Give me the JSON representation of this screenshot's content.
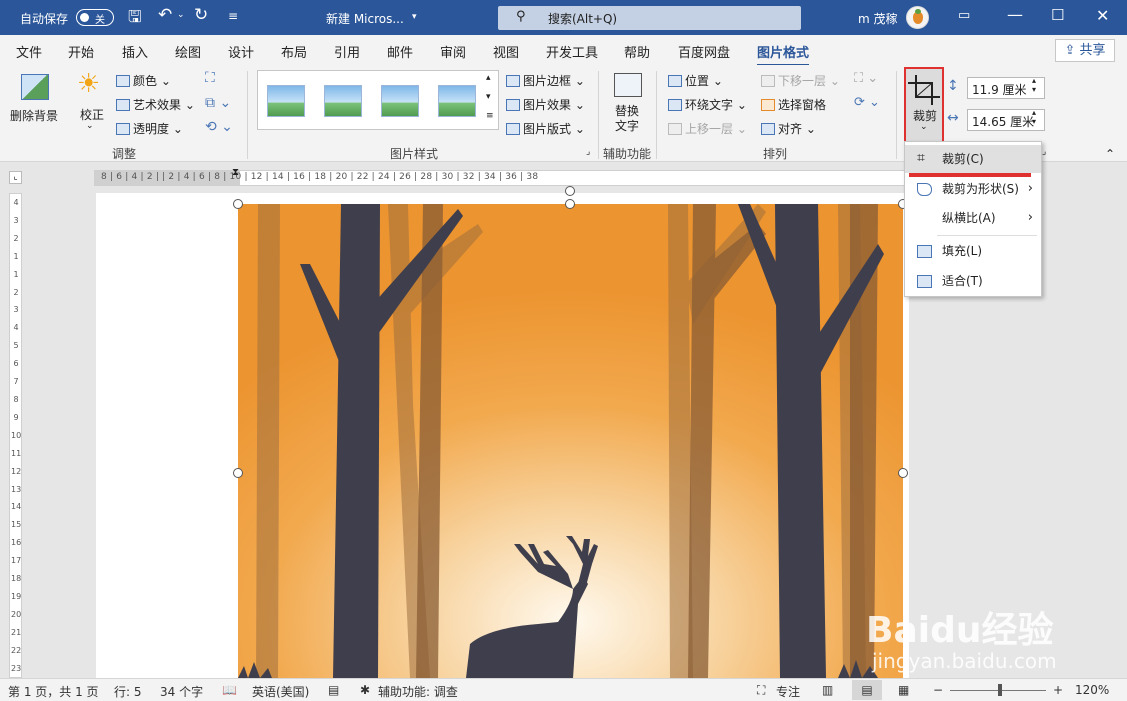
{
  "title_bar": {
    "autosave_label": "自动保存",
    "autosave_state": "关",
    "document_title": "新建 Micros...",
    "search_label": "搜索(Alt+Q)",
    "user_name": "m 茂稼"
  },
  "tabs": [
    "文件",
    "开始",
    "插入",
    "绘图",
    "设计",
    "布局",
    "引用",
    "邮件",
    "审阅",
    "视图",
    "开发工具",
    "帮助",
    "百度网盘",
    "图片格式"
  ],
  "active_tab": "图片格式",
  "share_label": "共享",
  "ribbon": {
    "adjust": {
      "remove_bg": "删除背景",
      "corrections": "校正",
      "color": "颜色",
      "artistic": "艺术效果",
      "transparency": "透明度",
      "group_label": "调整"
    },
    "styles": {
      "group_label": "图片样式",
      "border": "图片边框",
      "effects": "图片效果",
      "layout": "图片版式"
    },
    "accessibility": {
      "alt_text_line1": "替换",
      "alt_text_line2": "文字",
      "group_label": "辅助功能"
    },
    "arrange": {
      "position": "位置",
      "wrap": "环绕文字",
      "bring_forward": "上移一层",
      "send_backward": "下移一层",
      "selection_pane": "选择窗格",
      "align": "对齐",
      "group_label": "排列"
    },
    "size": {
      "crop": "裁剪",
      "height": "11.9 厘米",
      "width": "14.65 厘米"
    }
  },
  "crop_menu": [
    {
      "label": "裁剪(C)",
      "arrow": false
    },
    {
      "label": "裁剪为形状(S)",
      "arrow": true
    },
    {
      "label": "纵横比(A)",
      "arrow": true
    },
    {
      "label": "填充(L)",
      "arrow": false
    },
    {
      "label": "适合(T)",
      "arrow": false
    }
  ],
  "ruler": {
    "horizontal": "8 | 6 | 4 | 2 |   | 2 | 4 | 6 | 8 | 10 | 12 | 14 | 16 | 18 | 20 | 22 | 24 | 26 | 28 | 30 | 32 | 34 | 36 | 38",
    "vertical": [
      "4",
      "3",
      "2",
      "1",
      "1",
      "2",
      "3",
      "4",
      "5",
      "6",
      "7",
      "8",
      "9",
      "10",
      "11",
      "12",
      "13",
      "14",
      "15",
      "16",
      "17",
      "18",
      "19",
      "20",
      "21",
      "22",
      "23"
    ]
  },
  "status": {
    "page": "第 1 页，共 1 页",
    "line": "行: 5",
    "words": "34 个字",
    "language": "英语(美国)",
    "accessibility": "辅助功能: 调查",
    "focus": "专注",
    "zoom": "120%"
  },
  "watermark": {
    "brand": "Baidu经验",
    "url": "jingyan.baidu.com"
  },
  "colors": {
    "accent": "#2b579a",
    "highlight": "#e03131",
    "image_bg": "#f0a040"
  }
}
